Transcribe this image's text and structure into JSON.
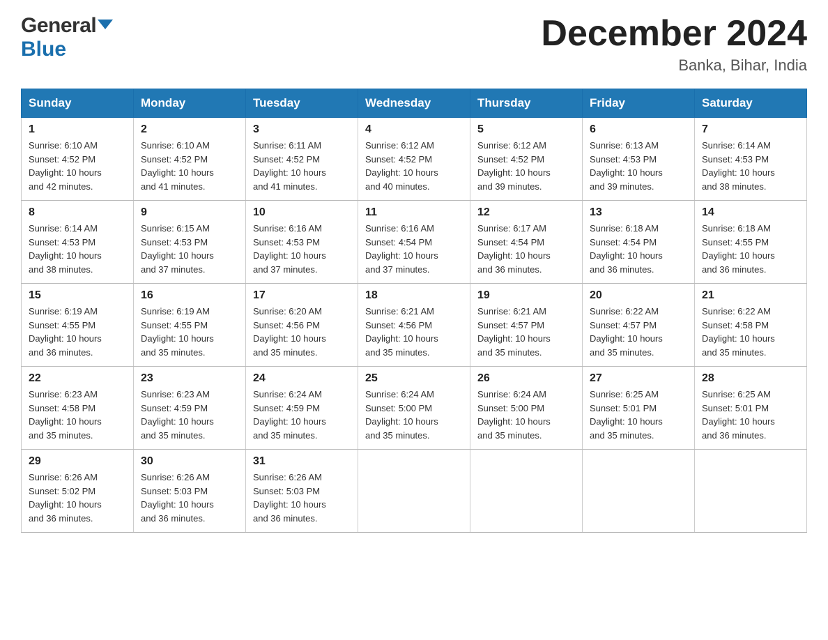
{
  "header": {
    "logo": {
      "general": "General",
      "blue": "Blue"
    },
    "title": "December 2024",
    "location": "Banka, Bihar, India"
  },
  "weekdays": [
    "Sunday",
    "Monday",
    "Tuesday",
    "Wednesday",
    "Thursday",
    "Friday",
    "Saturday"
  ],
  "weeks": [
    [
      {
        "day": "1",
        "sunrise": "6:10 AM",
        "sunset": "4:52 PM",
        "daylight": "10 hours and 42 minutes."
      },
      {
        "day": "2",
        "sunrise": "6:10 AM",
        "sunset": "4:52 PM",
        "daylight": "10 hours and 41 minutes."
      },
      {
        "day": "3",
        "sunrise": "6:11 AM",
        "sunset": "4:52 PM",
        "daylight": "10 hours and 41 minutes."
      },
      {
        "day": "4",
        "sunrise": "6:12 AM",
        "sunset": "4:52 PM",
        "daylight": "10 hours and 40 minutes."
      },
      {
        "day": "5",
        "sunrise": "6:12 AM",
        "sunset": "4:52 PM",
        "daylight": "10 hours and 39 minutes."
      },
      {
        "day": "6",
        "sunrise": "6:13 AM",
        "sunset": "4:53 PM",
        "daylight": "10 hours and 39 minutes."
      },
      {
        "day": "7",
        "sunrise": "6:14 AM",
        "sunset": "4:53 PM",
        "daylight": "10 hours and 38 minutes."
      }
    ],
    [
      {
        "day": "8",
        "sunrise": "6:14 AM",
        "sunset": "4:53 PM",
        "daylight": "10 hours and 38 minutes."
      },
      {
        "day": "9",
        "sunrise": "6:15 AM",
        "sunset": "4:53 PM",
        "daylight": "10 hours and 37 minutes."
      },
      {
        "day": "10",
        "sunrise": "6:16 AM",
        "sunset": "4:53 PM",
        "daylight": "10 hours and 37 minutes."
      },
      {
        "day": "11",
        "sunrise": "6:16 AM",
        "sunset": "4:54 PM",
        "daylight": "10 hours and 37 minutes."
      },
      {
        "day": "12",
        "sunrise": "6:17 AM",
        "sunset": "4:54 PM",
        "daylight": "10 hours and 36 minutes."
      },
      {
        "day": "13",
        "sunrise": "6:18 AM",
        "sunset": "4:54 PM",
        "daylight": "10 hours and 36 minutes."
      },
      {
        "day": "14",
        "sunrise": "6:18 AM",
        "sunset": "4:55 PM",
        "daylight": "10 hours and 36 minutes."
      }
    ],
    [
      {
        "day": "15",
        "sunrise": "6:19 AM",
        "sunset": "4:55 PM",
        "daylight": "10 hours and 36 minutes."
      },
      {
        "day": "16",
        "sunrise": "6:19 AM",
        "sunset": "4:55 PM",
        "daylight": "10 hours and 35 minutes."
      },
      {
        "day": "17",
        "sunrise": "6:20 AM",
        "sunset": "4:56 PM",
        "daylight": "10 hours and 35 minutes."
      },
      {
        "day": "18",
        "sunrise": "6:21 AM",
        "sunset": "4:56 PM",
        "daylight": "10 hours and 35 minutes."
      },
      {
        "day": "19",
        "sunrise": "6:21 AM",
        "sunset": "4:57 PM",
        "daylight": "10 hours and 35 minutes."
      },
      {
        "day": "20",
        "sunrise": "6:22 AM",
        "sunset": "4:57 PM",
        "daylight": "10 hours and 35 minutes."
      },
      {
        "day": "21",
        "sunrise": "6:22 AM",
        "sunset": "4:58 PM",
        "daylight": "10 hours and 35 minutes."
      }
    ],
    [
      {
        "day": "22",
        "sunrise": "6:23 AM",
        "sunset": "4:58 PM",
        "daylight": "10 hours and 35 minutes."
      },
      {
        "day": "23",
        "sunrise": "6:23 AM",
        "sunset": "4:59 PM",
        "daylight": "10 hours and 35 minutes."
      },
      {
        "day": "24",
        "sunrise": "6:24 AM",
        "sunset": "4:59 PM",
        "daylight": "10 hours and 35 minutes."
      },
      {
        "day": "25",
        "sunrise": "6:24 AM",
        "sunset": "5:00 PM",
        "daylight": "10 hours and 35 minutes."
      },
      {
        "day": "26",
        "sunrise": "6:24 AM",
        "sunset": "5:00 PM",
        "daylight": "10 hours and 35 minutes."
      },
      {
        "day": "27",
        "sunrise": "6:25 AM",
        "sunset": "5:01 PM",
        "daylight": "10 hours and 35 minutes."
      },
      {
        "day": "28",
        "sunrise": "6:25 AM",
        "sunset": "5:01 PM",
        "daylight": "10 hours and 36 minutes."
      }
    ],
    [
      {
        "day": "29",
        "sunrise": "6:26 AM",
        "sunset": "5:02 PM",
        "daylight": "10 hours and 36 minutes."
      },
      {
        "day": "30",
        "sunrise": "6:26 AM",
        "sunset": "5:03 PM",
        "daylight": "10 hours and 36 minutes."
      },
      {
        "day": "31",
        "sunrise": "6:26 AM",
        "sunset": "5:03 PM",
        "daylight": "10 hours and 36 minutes."
      },
      null,
      null,
      null,
      null
    ]
  ],
  "labels": {
    "sunrise": "Sunrise:",
    "sunset": "Sunset:",
    "daylight": "Daylight:"
  }
}
